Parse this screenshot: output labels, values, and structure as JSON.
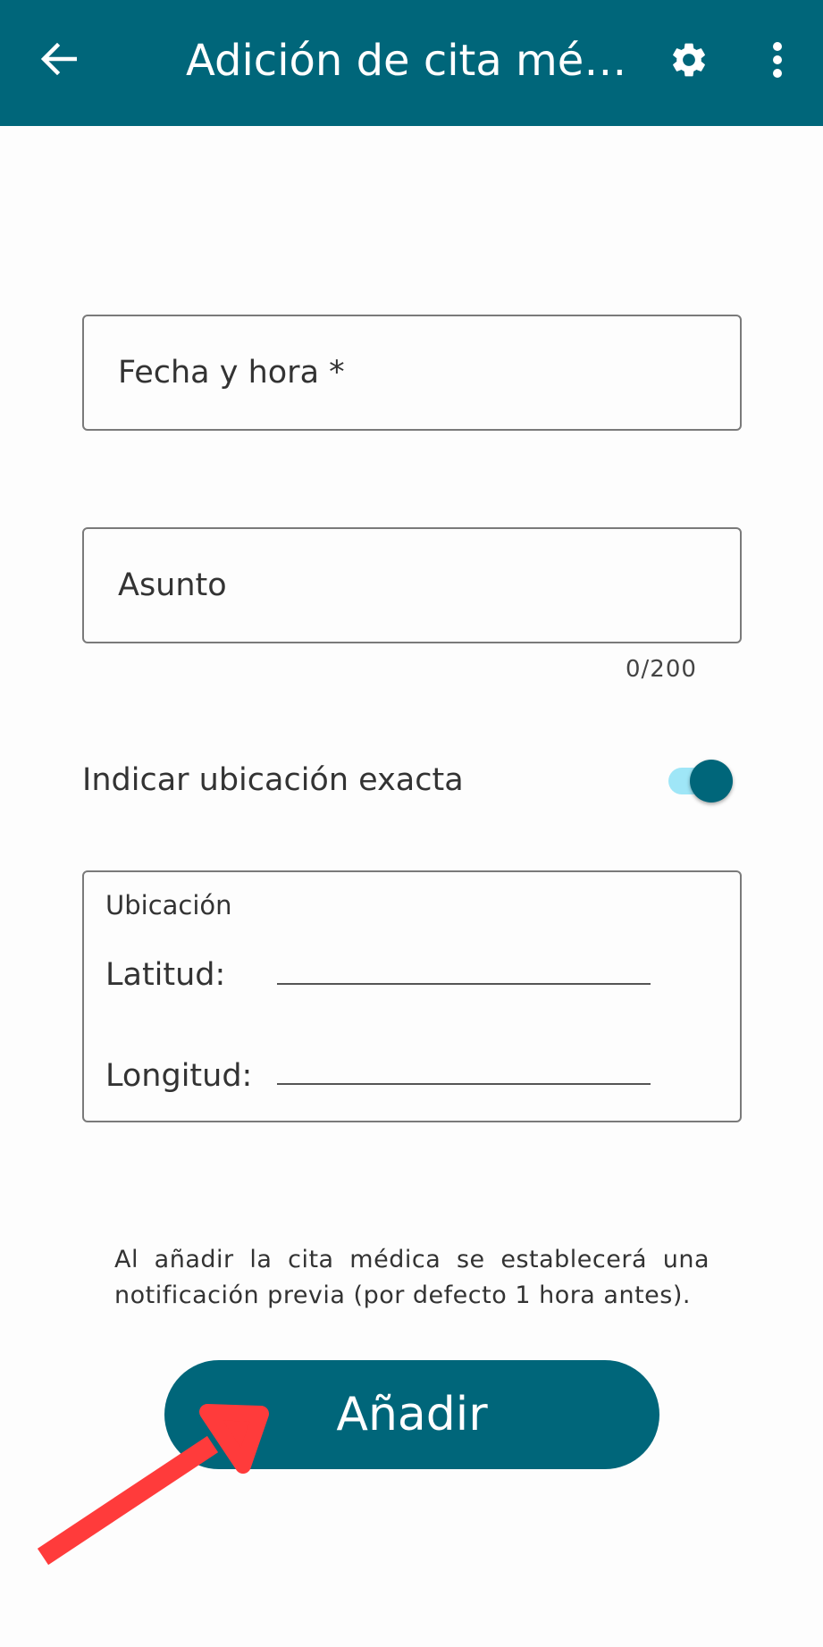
{
  "appbar": {
    "title": "Adición de cita médica",
    "back_icon": "arrow-left-icon",
    "settings_icon": "gear-icon",
    "more_icon": "more-vert-icon",
    "color": "#00667a"
  },
  "form": {
    "date_field": {
      "placeholder": "Fecha y hora *",
      "value": ""
    },
    "subject_field": {
      "placeholder": "Asunto",
      "value": "",
      "counter": "0/200"
    },
    "exact_location": {
      "label": "Indicar ubicación exacta",
      "on": true
    },
    "location": {
      "legend": "Ubicación",
      "latitude_label": "Latitud:",
      "latitude_value": "",
      "longitude_label": "Longitud:",
      "longitude_value": ""
    },
    "note": "Al añadir la cita médica se establecerá una notificación previa (por defecto 1 hora antes).",
    "add_button": "Añadir"
  },
  "annotation": {
    "type": "red-arrow",
    "points_to": "add-button",
    "color": "#ff3b3b"
  }
}
